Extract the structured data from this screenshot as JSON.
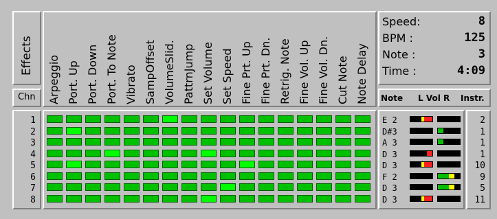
{
  "effects_title": "Effects",
  "chn_label": "Chn",
  "effects": [
    "Arpeggio",
    "Port. Up",
    "Port. Down",
    "Port. To Note",
    "Vibrato",
    "SampOffset",
    "VolumeSlid.",
    "PattrnJump",
    "Set Volume",
    "Set Speed",
    "Fine Prt. Up",
    "Fine Prt. Dn.",
    "Retrig. Note",
    "Fine Vol. Up",
    "Fine Vol. Dn.",
    "Cut Note",
    "Note Delay"
  ],
  "channels": [
    "1",
    "2",
    "3",
    "4",
    "5",
    "6",
    "7",
    "8"
  ],
  "colors": {
    "cell_on": "#00c000",
    "cell_lit": "#00ff00",
    "border_dark": "#006000"
  },
  "active_cells": [
    [
      0,
      6
    ],
    [
      1,
      1
    ],
    [
      3,
      3
    ],
    [
      3,
      8
    ],
    [
      4,
      1
    ],
    [
      4,
      10
    ],
    [
      7,
      8
    ],
    [
      6,
      9
    ]
  ],
  "status": {
    "speed_label": "Speed:",
    "speed_value": "8",
    "bpm_label": "BPM   :",
    "bpm_value": "125",
    "note_label": "Note   :",
    "note_value": "3",
    "time_label": "Time  :",
    "time_value": "4:09"
  },
  "headers": {
    "note": "Note",
    "vol": "L Vol R",
    "instr": "Instr."
  },
  "notes": [
    "E 2",
    "D#3",
    "A 3",
    "D 3",
    "D 3",
    "F 2",
    "D 3",
    "D 3"
  ],
  "volumes": [
    {
      "l": 0.5,
      "r": 0.0
    },
    {
      "l": 0.0,
      "r": 0.25
    },
    {
      "l": 0.0,
      "r": 0.2
    },
    {
      "l": 0.25,
      "r": 0.0
    },
    {
      "l": 0.5,
      "r": 0.0
    },
    {
      "l": 0.0,
      "r": 0.75
    },
    {
      "l": 0.0,
      "r": 0.75
    },
    {
      "l": 0.4,
      "r": 0.0
    }
  ],
  "instruments": [
    "2",
    "1",
    "1",
    "1",
    "10",
    "9",
    "5",
    "11"
  ]
}
